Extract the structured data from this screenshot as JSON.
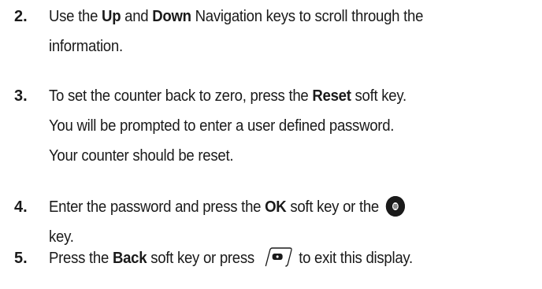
{
  "steps": [
    {
      "num": "2.",
      "line1_a": "Use the ",
      "line1_b": "Up",
      "line1_c": " and ",
      "line1_d": "Down",
      "line1_e": " Navigation keys to scroll through the",
      "line2": "information."
    },
    {
      "num": "3.",
      "line1_a": "To set the counter back to zero, press the ",
      "line1_b": "Reset",
      "line1_c": " soft key.",
      "line2": "You will be prompted to enter a user defined password.",
      "line3": "Your counter should be reset."
    },
    {
      "num": "4.",
      "line1_a": "Enter the password and press the ",
      "line1_b": "OK",
      "line1_c": " soft key or the ",
      "line2": "key.",
      "icon": "ok-center-key-icon"
    },
    {
      "num": "5.",
      "line1_a": "Press the ",
      "line1_b": "Back",
      "line1_c": " soft key or press ",
      "line1_d": " to exit this display.",
      "icon": "end-power-key-icon"
    }
  ]
}
